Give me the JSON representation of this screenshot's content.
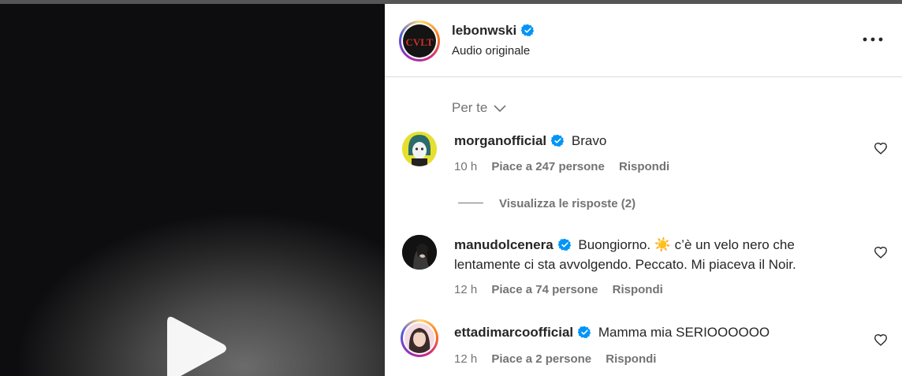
{
  "header": {
    "username": "lebonwski",
    "subtitle": "Audio originale",
    "avatar_logo_text": "CVLT",
    "more_icon": "more-horizontal-icon"
  },
  "sort": {
    "label": "Per te"
  },
  "comments": [
    {
      "username": "morganofficial",
      "text": "Bravo",
      "time": "10 h",
      "likes": "Piace a 247 persone",
      "reply": "Rispondi",
      "view_replies": "Visualizza le risposte (2)"
    },
    {
      "username": "manudolcenera",
      "text": "Buongiorno. ☀️ c’è un velo nero che lentamente ci sta avvolgendo. Peccato. Mi piaceva il Noir.",
      "time": "12 h",
      "likes": "Piace a 74 persone",
      "reply": "Rispondi"
    },
    {
      "username": "ettadimarcoofficial",
      "text": "Mamma mia SERIOOOOOO",
      "time": "12 h",
      "likes": "Piace a 2 persone",
      "reply": "Rispondi"
    }
  ],
  "colors": {
    "verified": "#0095f6",
    "muted": "#737373",
    "text": "#262626"
  }
}
